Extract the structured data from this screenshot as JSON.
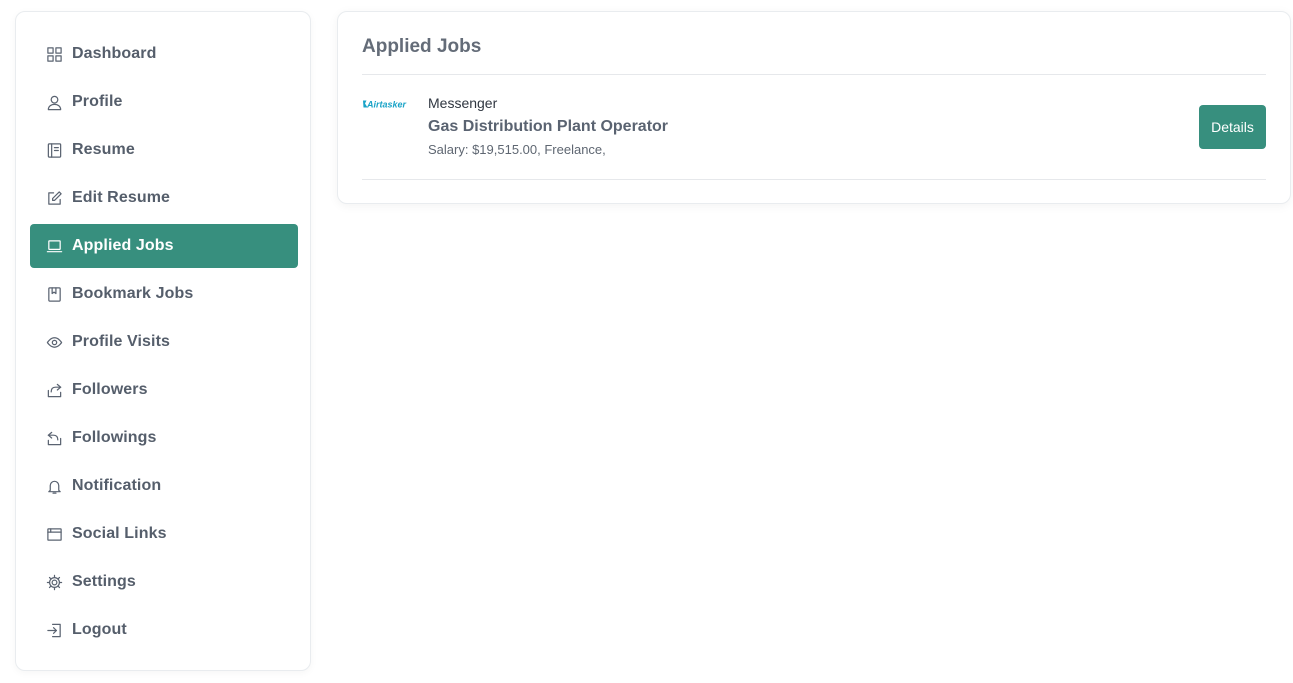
{
  "sidebar": {
    "items": [
      {
        "label": "Dashboard",
        "icon": "dashboard-grid-icon",
        "active": false
      },
      {
        "label": "Profile",
        "icon": "user-icon",
        "active": false
      },
      {
        "label": "Resume",
        "icon": "resume-book-icon",
        "active": false
      },
      {
        "label": "Edit Resume",
        "icon": "edit-icon",
        "active": false
      },
      {
        "label": "Applied Jobs",
        "icon": "laptop-icon",
        "active": true
      },
      {
        "label": "Bookmark Jobs",
        "icon": "bookmark-book-icon",
        "active": false
      },
      {
        "label": "Profile Visits",
        "icon": "eye-icon",
        "active": false
      },
      {
        "label": "Followers",
        "icon": "share-out-icon",
        "active": false
      },
      {
        "label": "Followings",
        "icon": "share-back-icon",
        "active": false
      },
      {
        "label": "Notification",
        "icon": "bell-icon",
        "active": false
      },
      {
        "label": "Social Links",
        "icon": "browser-window-icon",
        "active": false
      },
      {
        "label": "Settings",
        "icon": "gear-icon",
        "active": false
      },
      {
        "label": "Logout",
        "icon": "logout-icon",
        "active": false
      }
    ]
  },
  "main": {
    "title": "Applied Jobs",
    "jobs": [
      {
        "logo_text": "Airtasker",
        "company": "Messenger",
        "title": "Gas Distribution Plant Operator",
        "salary": "Salary: $19,515.00, Freelance,",
        "details_label": "Details"
      }
    ]
  },
  "colors": {
    "accent": "#378f7e",
    "logo": "#1aa3c7"
  }
}
